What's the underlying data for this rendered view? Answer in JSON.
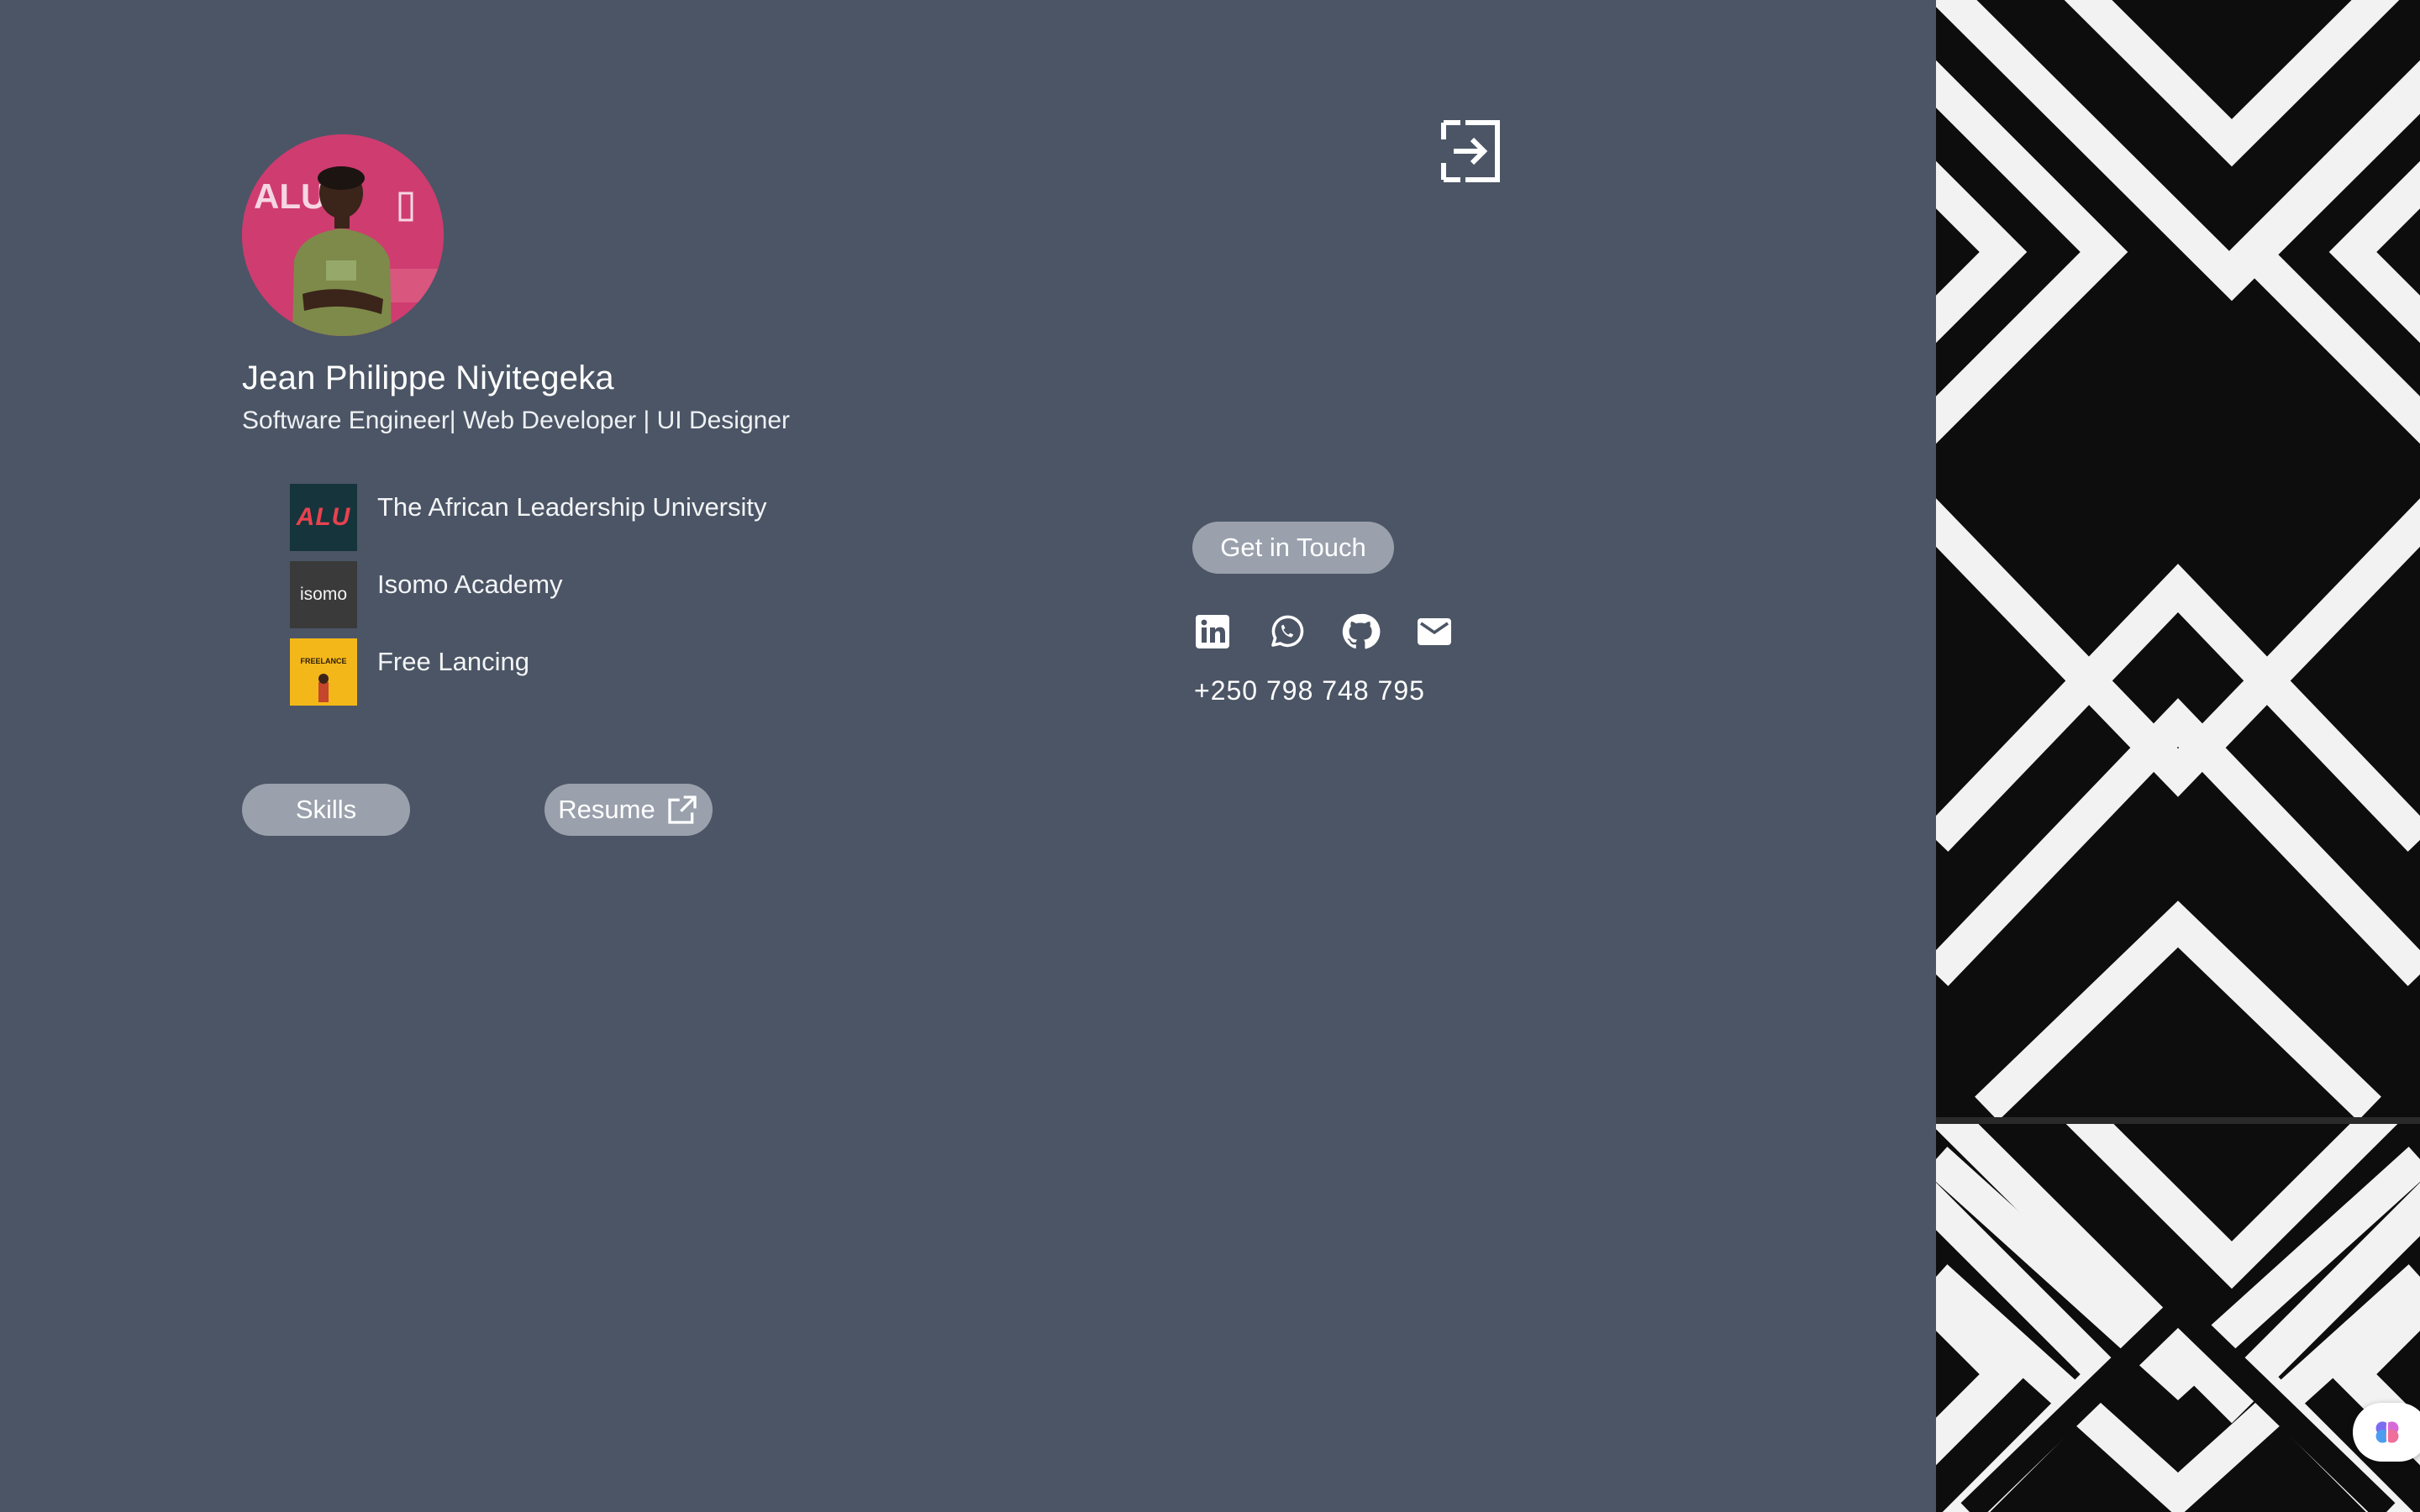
{
  "profile": {
    "name": "Jean Philippe Niyitegeka",
    "role": "Software Engineer| Web Developer | UI Designer",
    "avatar_logo_text": "ALU"
  },
  "organizations": [
    {
      "name": "The African Leadership University",
      "logo_text": "ALU",
      "logo_color": "#16343c"
    },
    {
      "name": "Isomo Academy",
      "logo_text": "isomo",
      "logo_color": "#3a3a3a"
    },
    {
      "name": "Free Lancing",
      "logo_text": "FREELANCE",
      "logo_color": "#f4b71a"
    }
  ],
  "buttons": {
    "skills": "Skills",
    "resume": "Resume",
    "get_in_touch": "Get in Touch"
  },
  "contact": {
    "phone": "+250 798 748 795",
    "icons": [
      "linkedin-icon",
      "whatsapp-icon",
      "github-icon",
      "mail-icon"
    ]
  },
  "colors": {
    "background": "#4b5565",
    "pill": "#9aa1ad",
    "text": "#ffffff"
  }
}
